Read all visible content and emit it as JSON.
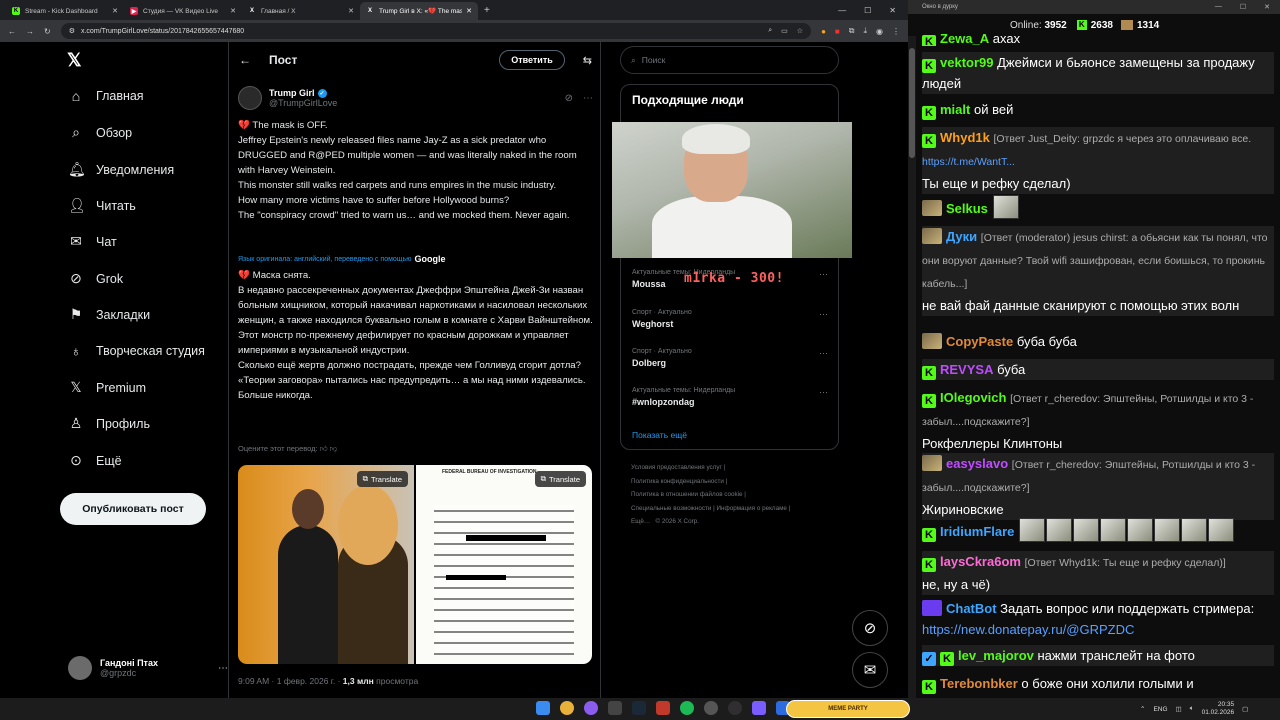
{
  "tabs": [
    {
      "label": "Stream - Kick Dashboard",
      "fav": "K",
      "favColor": "#53fc18"
    },
    {
      "label": "Студия — VK Видео Live",
      "fav": "▶",
      "favColor": "#e0234e"
    },
    {
      "label": "Главная / X",
      "fav": "X",
      "favColor": "#000000"
    },
    {
      "label": "Trump Girl в X: «💔 The mask is...",
      "fav": "X",
      "favColor": "#000000"
    }
  ],
  "url": "x.com/TrumpGirlLove/status/2017842655657447680",
  "nav": {
    "items": [
      {
        "label": "Главная",
        "icon": "⌂"
      },
      {
        "label": "Обзор",
        "icon": "⌕"
      },
      {
        "label": "Уведомления",
        "icon": "🔔"
      },
      {
        "label": "Читать",
        "icon": "👤"
      },
      {
        "label": "Чат",
        "icon": "✉"
      },
      {
        "label": "Grok",
        "icon": "◎"
      },
      {
        "label": "Закладки",
        "icon": "🔖"
      },
      {
        "label": "Творческая студия",
        "icon": "⚙"
      },
      {
        "label": "Premium",
        "icon": "𝕏"
      },
      {
        "label": "Профиль",
        "icon": "👤"
      },
      {
        "label": "Ещё",
        "icon": "⋯"
      }
    ],
    "post_button": "Опубликовать пост",
    "account": {
      "name": "Гандоні Птах",
      "handle": "@grpzdc"
    }
  },
  "main": {
    "title": "Пост",
    "reply_label": "Ответить",
    "author": {
      "name": "Trump Girl",
      "handle": "@TrumpGirlLove"
    },
    "text_en": [
      "💔 The mask is OFF.",
      "Jeffrey Epstein's newly released files name Jay-Z as a sick predator who DRUGGED and R@PED multiple women — and was literally naked in the room with Harvey Weinstein.",
      "This monster still walks red carpets and runs empires in the music industry.",
      "How many more victims have to suffer before Hollywood burns?",
      "The \"conspiracy crowd\" tried to warn us… and we mocked them. Never again."
    ],
    "translated_note": "Язык оригинала: английский, переведено с помощью",
    "translated_provider": "Google",
    "text_ru": [
      "💔 Маска снята.",
      "В недавно рассекреченных документах Джеффри Эпштейна Джей-Зи назван больным хищником, который накачивал наркотиками и насиловал нескольких женщин, а также находился буквально голым в комнате с Харви Вайнштейном.",
      "Этот монстр по-прежнему дефилирует по красным дорожкам и управляет империями в музыкальной индустрии.",
      "Сколько ещё жертв должно пострадать, прежде чем Голливуд сгорит дотла?",
      "«Теории заговора» пытались нас предупредить… а мы над ними издевались. Больше никогда."
    ],
    "rate_translation": "Оцените этот перевод:",
    "translate_label": "Translate",
    "fbi_header": "FEDERAL BUREAU OF INVESTIGATION",
    "time": "9:09 AM · 1 февр. 2026 г. ·",
    "views": "1,3 млн",
    "views_label": "просмотра"
  },
  "right": {
    "search_placeholder": "Поиск",
    "people_title": "Подходящие люди",
    "trends": [
      {
        "category": "Актуальные темы: Нидерланды",
        "name": "Moussa"
      },
      {
        "category": "Спорт · Актуально",
        "name": "Weghorst"
      },
      {
        "category": "Спорт · Актуально",
        "name": "Dolberg"
      },
      {
        "category": "Актуальные темы: Нидерланды",
        "name": "#wnlopzondag"
      }
    ],
    "show_more": "Показать ещё",
    "footer": [
      "Условия предоставления услуг",
      "Политика конфиденциальности",
      "Политика в отношении файлов cookie",
      "Специальные возможности",
      "Информация о рекламе",
      "Ещё…",
      "© 2026 X Corp."
    ]
  },
  "stream_overlay": "m1rka - 300!",
  "chat": {
    "window_title": "Окно в дурку",
    "online_label": "Online:",
    "online": "3952",
    "kick_count": "2638",
    "other_count": "1314",
    "messages": [
      {
        "user": "Zewa_A",
        "color": "#53fc18",
        "text": "ахах"
      },
      {
        "user": "vektor99",
        "color": "#53fc18",
        "text": "Джеймси и бьяонсе замещены за продажу людей"
      },
      {
        "user": "mialt",
        "color": "#53fc18",
        "text": "ой вей"
      },
      {
        "user": "Whyd1k",
        "color": "#ff9f1c",
        "reply": "[Ответ Just_Deity: grpzdc я через это оплачиваю все.",
        "link": "https://t.me/WantT...",
        "text": "Ты еще и рефку сделал)"
      },
      {
        "user": "Selkus",
        "color": "#53fc18",
        "text": ""
      },
      {
        "user": "Дуки",
        "color": "#3ea6ff",
        "reply": "[Ответ (moderator) jesus chirst: а обьясни как ты понял, что они воруют данные? Твой wifi зашифрован, если боишься, то прокинь кабель...]",
        "text": "не вай фай данные сканируют с помощью этих волн"
      },
      {
        "user": "CopyPaste",
        "color": "#e08a3a",
        "text": "буба буба"
      },
      {
        "user": "REVYSA",
        "color": "#c04cff",
        "text": "буба"
      },
      {
        "user": "IOlegovich",
        "color": "#53fc18",
        "reply": "[Ответ r_cheredov: Эпштейны, Ротшилды и кто 3 - забыл....подскажите?]",
        "text": "Рокфеллеры Клинтоны"
      },
      {
        "user": "easyslavo",
        "color": "#c04cff",
        "reply": "[Ответ r_cheredov: Эпштейны, Ротшилды и кто 3 - забыл....подскажите?]",
        "text": "Жириновские"
      },
      {
        "user": "IridiumFlare",
        "color": "#3ea6ff",
        "text": ""
      },
      {
        "user": "laysCkra6om",
        "color": "#ff6ad5",
        "reply": "[Ответ Whyd1k: Ты еще и рефку сделал)]",
        "text": "не, ну а чё)"
      },
      {
        "user": "ChatBot",
        "color": "#3ea6ff",
        "text": "Задать вопрос или поддержать стримера:",
        "link": "https://new.donatepay.ru/@GRPZDC"
      },
      {
        "user": "lev_majorov",
        "color": "#53fc18",
        "text": "нажми транслейт на фото"
      },
      {
        "user": "Terebonbker",
        "color": "#e08a3a",
        "text": "о боже они холили голыми и"
      }
    ]
  },
  "taskbar": {
    "meme_label": "MEME PARTY",
    "lang": "ENG",
    "time": "20:35",
    "date": "01.02.2026"
  }
}
